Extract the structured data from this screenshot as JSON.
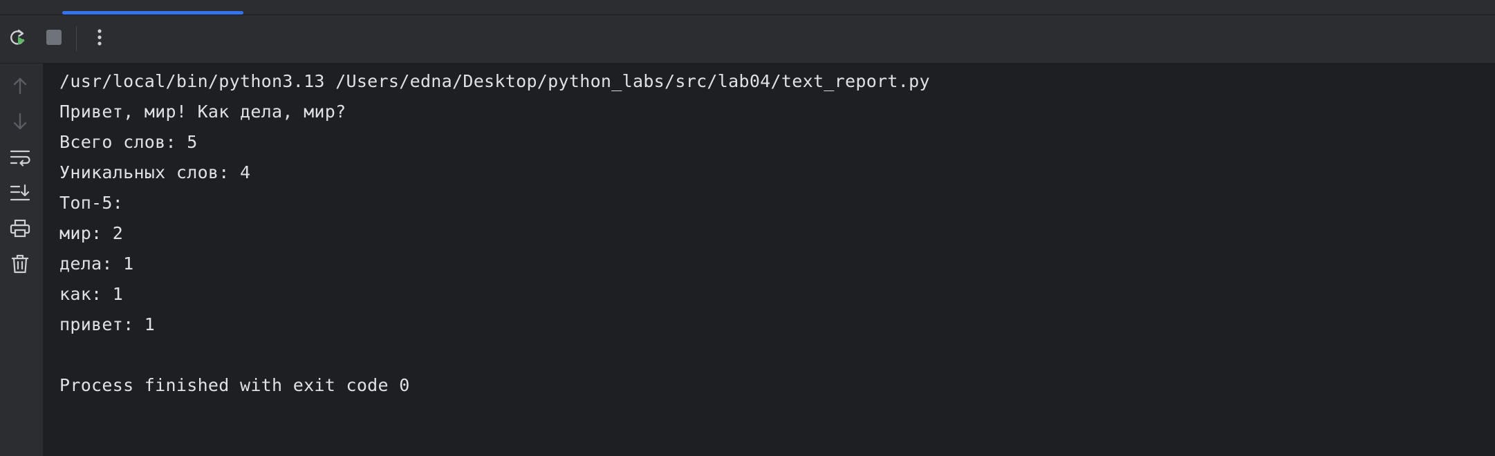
{
  "toolbar": {
    "rerun_icon": "rerun-icon",
    "stop_icon": "stop-icon",
    "more_icon": "more-vertical-icon"
  },
  "gutter": {
    "icons": [
      "arrow-up-icon",
      "arrow-down-icon",
      "soft-wrap-icon",
      "scroll-to-end-icon",
      "print-icon",
      "trash-icon"
    ]
  },
  "console": {
    "lines": [
      "/usr/local/bin/python3.13 /Users/edna/Desktop/python_labs/src/lab04/text_report.py",
      "Привет, мир! Как дела, мир?",
      "Всего слов: 5",
      "Уникальных слов: 4",
      "Топ-5:",
      "мир: 2",
      "дела: 1",
      "как: 1",
      "привет: 1",
      "",
      "Process finished with exit code 0"
    ]
  },
  "colors": {
    "background": "#1e1f22",
    "panel": "#2b2d30",
    "text": "#dfe1e5",
    "accent": "#3574f0",
    "run_green": "#5fb865"
  }
}
